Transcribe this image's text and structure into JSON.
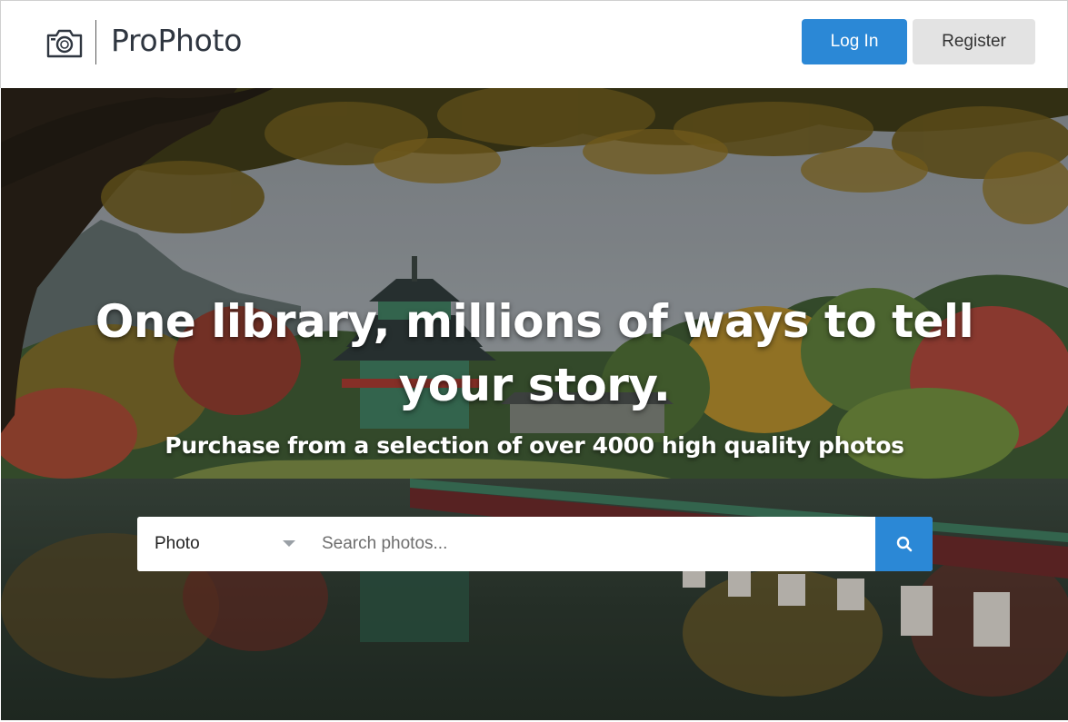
{
  "header": {
    "brand": "ProPhoto",
    "login_label": "Log In",
    "register_label": "Register",
    "logo_icon": "camera-icon"
  },
  "hero": {
    "headline": "One library, millions of ways to tell your story.",
    "subheadline": "Purchase from a selection of over 4000 high quality photos",
    "background": "photo of a pagoda pavilion on a lake with a red bridge and autumn trees"
  },
  "search": {
    "category_selected": "Photo",
    "placeholder": "Search photos...",
    "button_icon": "search-icon"
  },
  "colors": {
    "accent": "#2b88d6",
    "register_bg": "#e3e3e3",
    "brand_text": "#2f3640"
  }
}
